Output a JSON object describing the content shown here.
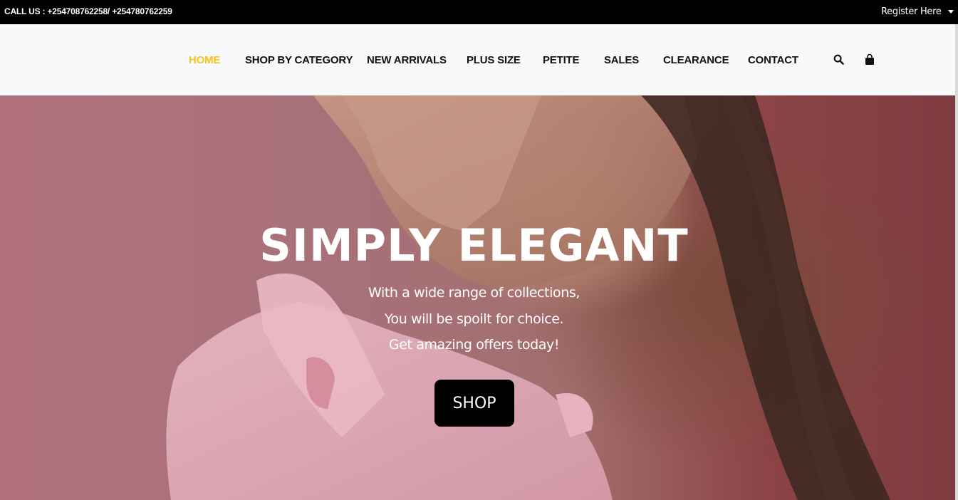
{
  "topbar": {
    "call_text": "CALL US : +254708762258/ +254780762259",
    "register_label": "Register Here"
  },
  "nav": {
    "items": [
      {
        "label": "HOME",
        "active": true
      },
      {
        "label": "SHOP BY CATEGORY"
      },
      {
        "label": "NEW ARRIVALS"
      },
      {
        "label": "PLUS SIZE"
      },
      {
        "label": "PETITE"
      },
      {
        "label": "SALES"
      },
      {
        "label": "CLEARANCE"
      },
      {
        "label": "CONTACT"
      }
    ],
    "icons": [
      "search-icon",
      "shopping-bag-icon"
    ],
    "active_color": "#f5c518"
  },
  "hero": {
    "title": "SIMPLY ELEGANT",
    "lines": [
      "With a wide range of collections,",
      "You will be spoilt for choice.",
      "Get amazing offers today!"
    ],
    "button_label": "SHOP"
  }
}
